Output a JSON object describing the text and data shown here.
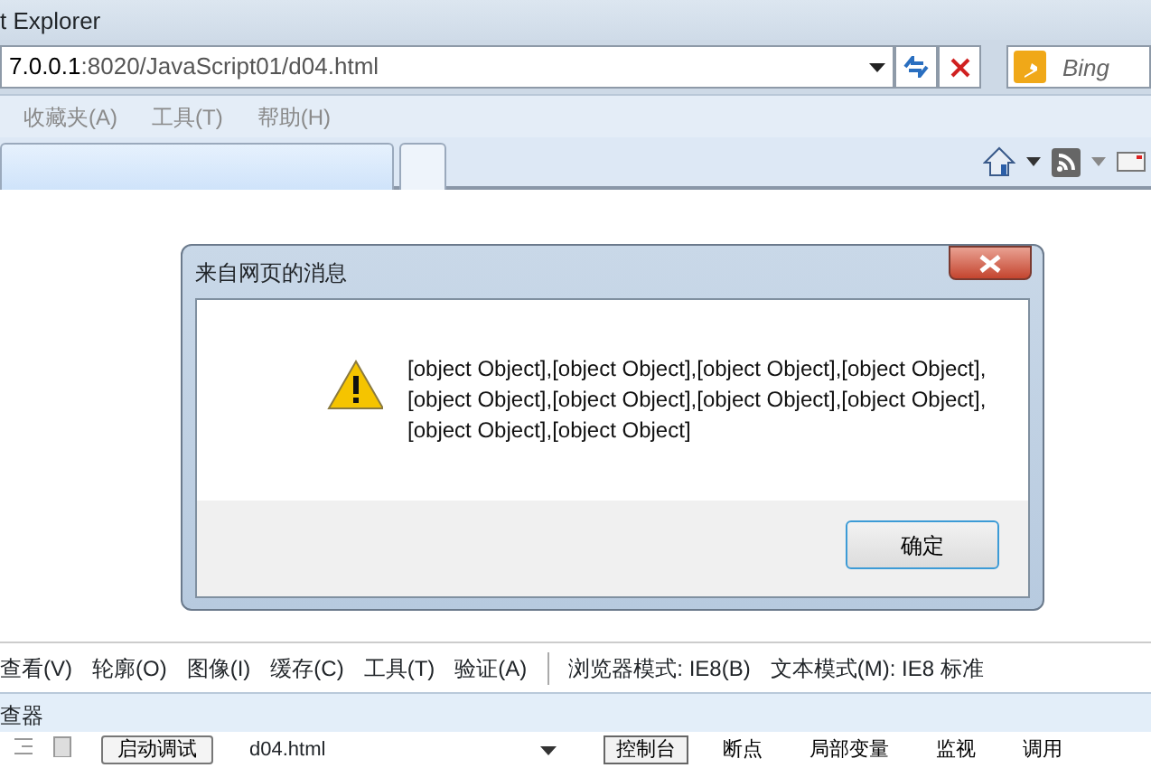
{
  "window": {
    "title": "t Explorer"
  },
  "address_bar": {
    "url_host": "7.0.0.1",
    "url_rest": ":8020/JavaScript01/d04.html"
  },
  "search": {
    "placeholder": "Bing"
  },
  "menu": [
    {
      "label": "收藏夹(A)",
      "disabled": true
    },
    {
      "label": "工具(T)",
      "disabled": true
    },
    {
      "label": "帮助(H)",
      "disabled": true
    }
  ],
  "tabs": [
    {
      "selected": true
    },
    {
      "selected": false
    }
  ],
  "dialog": {
    "title": "来自网页的消息",
    "message": "[object Object],[object Object],[object Object],[object Object],[object Object],[object Object],[object Object],[object Object],[object Object],[object Object]",
    "buttons": [
      "确定"
    ]
  },
  "devtools": {
    "menu": [
      "查看(V)",
      "轮廓(O)",
      "图像(I)",
      "缓存(C)",
      "工具(T)",
      "验证(A)"
    ],
    "modes": [
      "浏览器模式: IE8(B)",
      "文本模式(M):  IE8 标准"
    ],
    "panel_title": "查器",
    "debug_button": "启动调试",
    "script_select": "d04.html",
    "tabs": [
      {
        "label": "控制台",
        "selected": true
      },
      {
        "label": "断点",
        "selected": false
      },
      {
        "label": "局部变量",
        "selected": false
      },
      {
        "label": "监视",
        "selected": false
      },
      {
        "label": "调用",
        "selected": false
      }
    ]
  }
}
